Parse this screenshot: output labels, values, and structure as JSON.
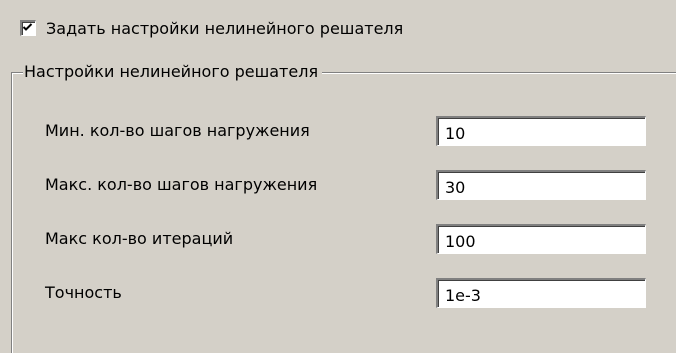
{
  "checkbox": {
    "label": "Задать настройки нелинейного решателя",
    "checked": true
  },
  "group": {
    "title": "Настройки нелинейного решателя"
  },
  "fields": [
    {
      "label": "Мин. кол-во шагов нагружения",
      "value": "10"
    },
    {
      "label": "Макс. кол-во шагов нагружения",
      "value": "30"
    },
    {
      "label": "Макс кол-во итераций",
      "value": "100"
    },
    {
      "label": "Точность",
      "value": "1e-3"
    }
  ]
}
